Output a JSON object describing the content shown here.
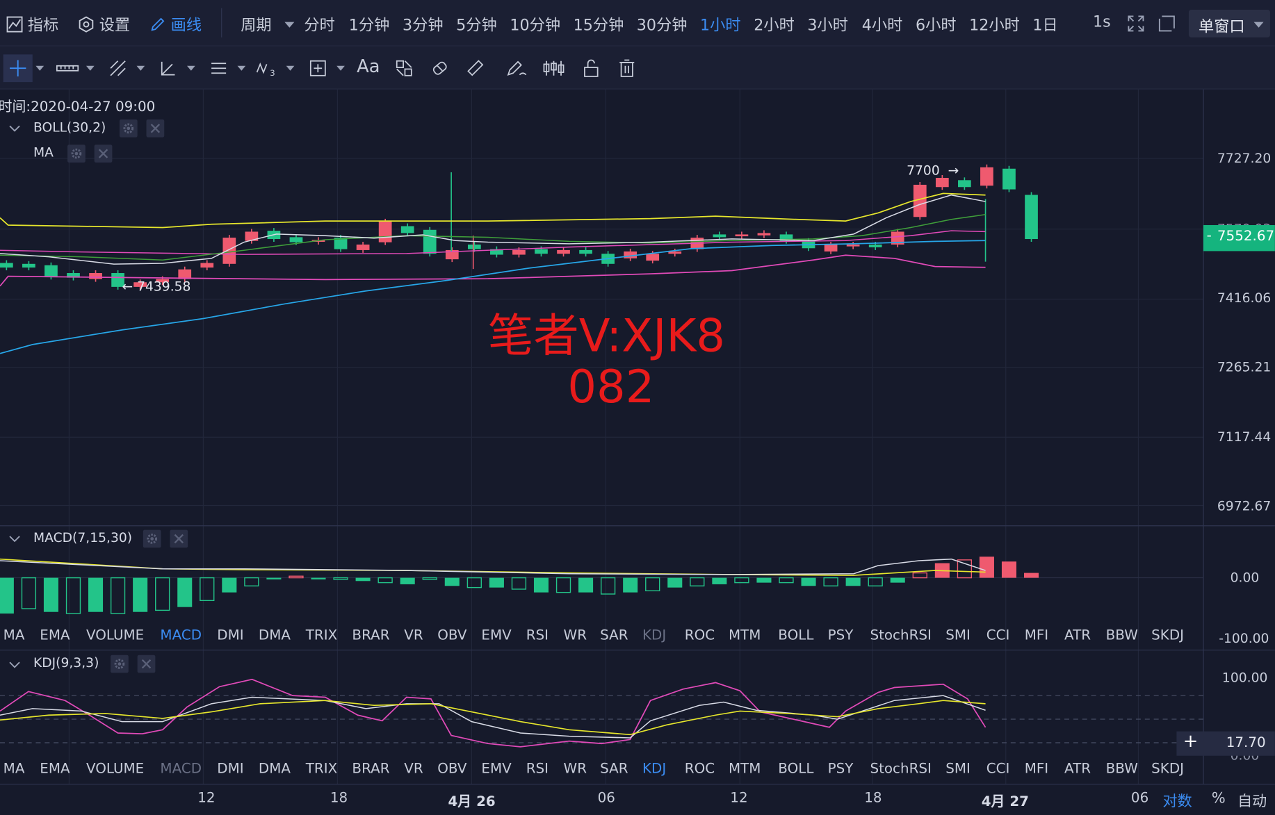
{
  "toolbar": {
    "indicator": "指标",
    "settings": "设置",
    "draw": "画线",
    "period": "周期",
    "timeframes": [
      "分时",
      "1分钟",
      "3分钟",
      "5分钟",
      "10分钟",
      "15分钟",
      "30分钟",
      "1小时",
      "2小时",
      "3小时",
      "4小时",
      "6小时",
      "12小时",
      "1日"
    ],
    "active_timeframe": "1小时",
    "interval": "1s",
    "window_mode": "单窗口"
  },
  "drawing_tools": [
    "crosshair-icon",
    "ruler-icon",
    "trend-line-icon",
    "angle-icon",
    "parallel-channel-icon",
    "fibonacci-icon",
    "measure-icon",
    "text-icon",
    "pattern-icon",
    "eraser-icon",
    "ruler-measure-icon",
    "brush-icon",
    "candle-icon",
    "lock-icon",
    "trash-icon"
  ],
  "main_chart": {
    "time_label": "时间:2020-04-27 09:00",
    "indicator1": "BOLL(30,2)",
    "indicator2": "MA",
    "price_ticks": [
      "7727.20",
      "7570.03",
      "7416.06",
      "7265.21",
      "7117.44",
      "6972.67"
    ],
    "current_price": "7552.67",
    "high_marker": "7700",
    "low_marker": "7439.58",
    "watermark_line1": "笔者V:XJK8",
    "watermark_line2": "082"
  },
  "macd_panel": {
    "label": "MACD(7,15,30)",
    "ticks": [
      "0.00",
      "-100.00"
    ]
  },
  "kdj_panel": {
    "label": "KDJ(9,3,3)",
    "ticks": [
      "100.00",
      "17.70",
      "0.00"
    ]
  },
  "indicator_tabs": [
    "MA",
    "EMA",
    "VOLUME",
    "MACD",
    "DMI",
    "DMA",
    "TRIX",
    "BRAR",
    "VR",
    "OBV",
    "EMV",
    "RSI",
    "WR",
    "SAR",
    "KDJ",
    "ROC",
    "MTM",
    "BOLL",
    "PSY",
    "StochRSI",
    "SMI",
    "CCI",
    "MFI",
    "ATR",
    "BBW",
    "SKDJ"
  ],
  "time_axis": [
    "12",
    "18",
    "4月 26",
    "06",
    "12",
    "18",
    "4月 27",
    "06"
  ],
  "axis_controls": {
    "log": "对数",
    "percent": "%",
    "auto": "自动"
  },
  "colors": {
    "up": "#ef5a6f",
    "down": "#23c489",
    "accent": "#3b8cf2",
    "boll_upper": "#e6e62c",
    "boll_lower": "#e04ab8",
    "ma_long": "#27a6e8"
  },
  "chart_data": {
    "type": "candlestick",
    "candles": [
      {
        "o": 7500,
        "c": 7490
      },
      {
        "o": 7498,
        "c": 7490
      },
      {
        "o": 7495,
        "c": 7470
      },
      {
        "o": 7478,
        "c": 7468
      },
      {
        "o": 7465,
        "c": 7478
      },
      {
        "o": 7478,
        "c": 7448
      },
      {
        "o": 7448,
        "c": 7458
      },
      {
        "o": 7458,
        "c": 7465
      },
      {
        "o": 7465,
        "c": 7486
      },
      {
        "o": 7490,
        "c": 7500
      },
      {
        "o": 7498,
        "c": 7555
      },
      {
        "o": 7548,
        "c": 7568
      },
      {
        "o": 7570,
        "c": 7552
      },
      {
        "o": 7556,
        "c": 7545
      },
      {
        "o": 7546,
        "c": 7550
      },
      {
        "o": 7555,
        "c": 7530
      },
      {
        "o": 7528,
        "c": 7540
      },
      {
        "o": 7545,
        "c": 7590
      },
      {
        "o": 7580,
        "c": 7565
      },
      {
        "o": 7572,
        "c": 7520
      },
      {
        "o": 7508,
        "c": 7528
      },
      {
        "o": 7540,
        "c": 7530
      },
      {
        "o": 7530,
        "c": 7518
      },
      {
        "o": 7518,
        "c": 7528
      },
      {
        "o": 7530,
        "c": 7520
      },
      {
        "o": 7520,
        "c": 7528
      },
      {
        "o": 7528,
        "c": 7520
      },
      {
        "o": 7520,
        "c": 7498
      },
      {
        "o": 7510,
        "c": 7525
      },
      {
        "o": 7505,
        "c": 7520
      },
      {
        "o": 7520,
        "c": 7525
      },
      {
        "o": 7530,
        "c": 7555
      },
      {
        "o": 7562,
        "c": 7556
      },
      {
        "o": 7558,
        "c": 7562
      },
      {
        "o": 7560,
        "c": 7565
      },
      {
        "o": 7562,
        "c": 7548
      },
      {
        "o": 7548,
        "c": 7532
      },
      {
        "o": 7525,
        "c": 7540
      },
      {
        "o": 7536,
        "c": 7540
      },
      {
        "o": 7540,
        "c": 7534
      },
      {
        "o": 7540,
        "c": 7568
      },
      {
        "o": 7600,
        "c": 7670
      },
      {
        "o": 7665,
        "c": 7685
      },
      {
        "o": 7680,
        "c": 7665
      },
      {
        "o": 7668,
        "c": 7708
      },
      {
        "o": 7705,
        "c": 7660
      },
      {
        "o": 7648,
        "c": 7552
      }
    ]
  }
}
